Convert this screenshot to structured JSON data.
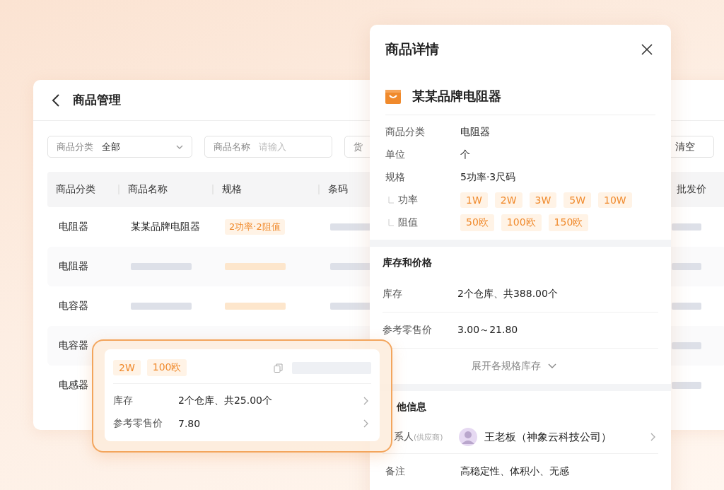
{
  "background_window": {
    "title": "商品管理",
    "filters": [
      {
        "kind": "select",
        "label": "商品分类",
        "value": "全部"
      },
      {
        "kind": "input",
        "label": "商品名称",
        "placeholder": "请输入"
      },
      {
        "kind": "input",
        "label": "货"
      }
    ],
    "clear_button": "清空",
    "table": {
      "columns": [
        "商品分类",
        "商品名称",
        "规格",
        "条码",
        "批发价"
      ],
      "rows": [
        {
          "category": "电阻器",
          "name": "某某品牌电阻器",
          "spec": "2功率·2阻值"
        },
        {
          "category": "电阻器"
        },
        {
          "category": "电容器"
        },
        {
          "category": "电容器"
        },
        {
          "category": "电感器"
        }
      ]
    }
  },
  "detail_panel": {
    "title": "商品详情",
    "product_name": "某某品牌电阻器",
    "attributes": [
      {
        "label": "商品分类",
        "value": "电阻器"
      },
      {
        "label": "单位",
        "value": "个"
      },
      {
        "label": "规格",
        "value": "5功率·3尺码"
      }
    ],
    "spec_groups": [
      {
        "label": "功率",
        "options": [
          "1W",
          "2W",
          "3W",
          "5W",
          "10W"
        ]
      },
      {
        "label": "阻值",
        "options": [
          "50欧",
          "100欧",
          "150欧"
        ]
      }
    ],
    "stock_section": {
      "title": "库存和价格",
      "rows": [
        {
          "label": "库存",
          "value": "2个仓库、共388.00个"
        },
        {
          "label": "参考零售价",
          "value": "3.00～21.80"
        }
      ],
      "expand_link": "展开各规格库存"
    },
    "other_section": {
      "title": "他信息",
      "contact": {
        "label": "系人",
        "sub": "(供应商)",
        "name": "王老板（神象云科技公司）"
      },
      "note": {
        "label": "备注",
        "value": "高稳定性、体积小、无感"
      }
    }
  },
  "popover": {
    "tags": [
      "2W",
      "100欧"
    ],
    "rows": [
      {
        "label": "库存",
        "value": "2个仓库、共25.00个"
      },
      {
        "label": "参考零售价",
        "value": "7.80"
      }
    ]
  }
}
